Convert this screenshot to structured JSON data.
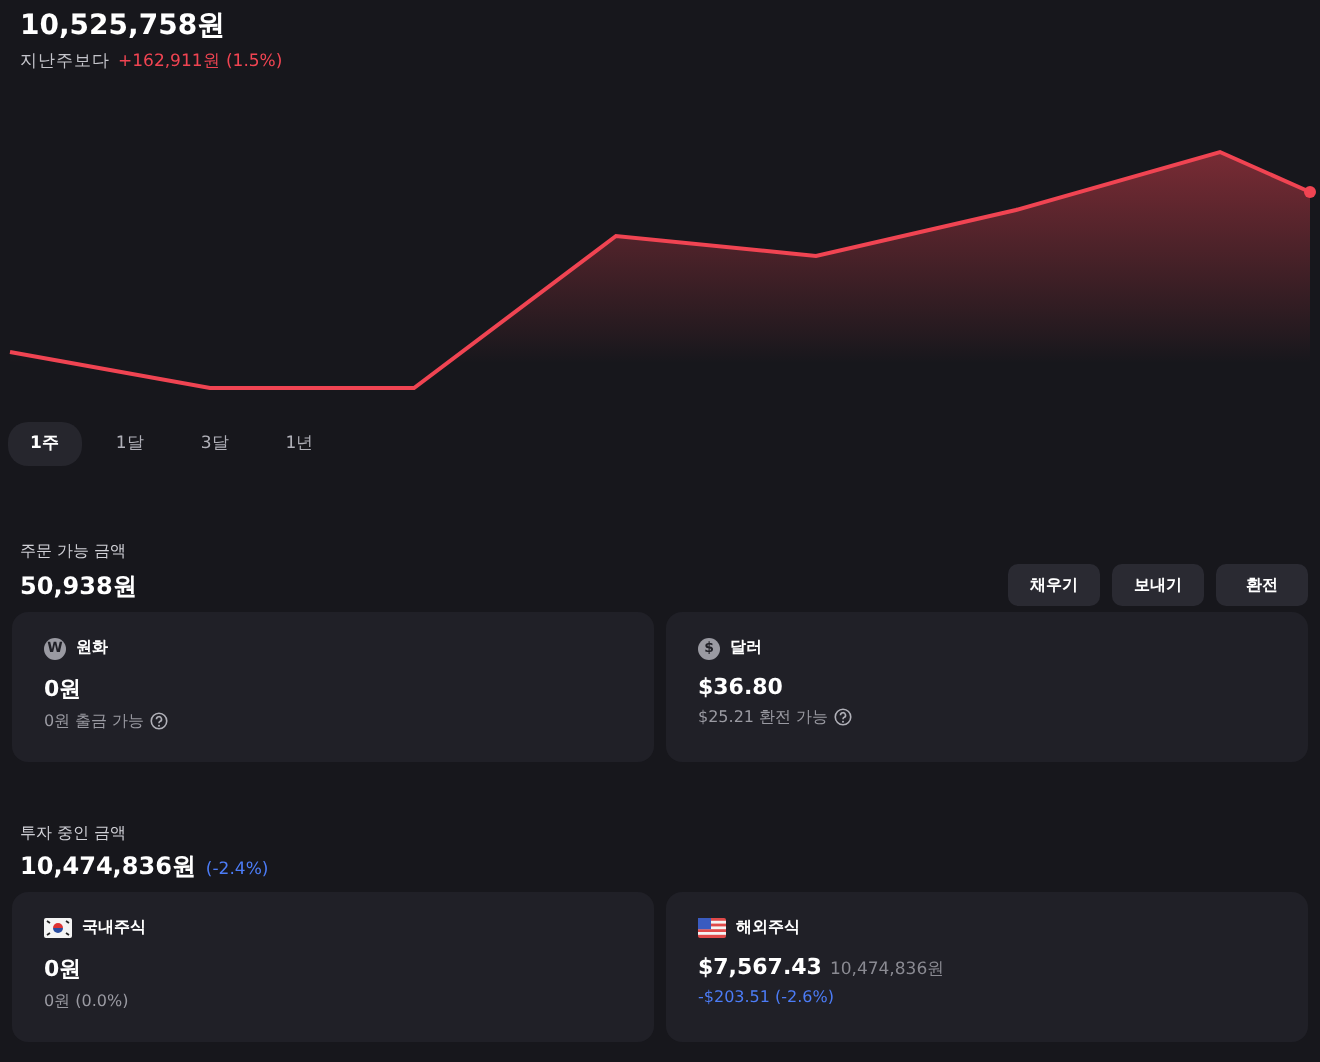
{
  "summary": {
    "total": "10,525,758원",
    "compare_label": "지난주보다",
    "change": "+162,911원 (1.5%)",
    "color": "#f04452"
  },
  "periods": [
    {
      "label": "1주",
      "selected": true
    },
    {
      "label": "1달",
      "selected": false
    },
    {
      "label": "3달",
      "selected": false
    },
    {
      "label": "1년",
      "selected": false
    }
  ],
  "orderable": {
    "label": "주문 가능 금액",
    "amount": "50,938원",
    "buttons": [
      "채우기",
      "보내기",
      "환전"
    ],
    "cards": [
      {
        "kind": "coin",
        "symbol": "W",
        "label": "원화",
        "amount": "0원",
        "detail": "0원 출금 가능",
        "help": true,
        "color": "#9a9aa2"
      },
      {
        "kind": "coin",
        "symbol": "$",
        "label": "달러",
        "amount": "$36.80",
        "detail": "$25.21 환전 가능",
        "help": true,
        "color": "#9a9aa2"
      }
    ]
  },
  "investing": {
    "label": "투자 중인 금액",
    "amount": "10,474,836원",
    "change": "(-2.4%)",
    "color": "#4c7cf6",
    "cards": [
      {
        "kind": "flag-kr",
        "label": "국내주식",
        "amount": "0원",
        "detail": "0원 (0.0%)",
        "help": false,
        "color": "#9a9aa2"
      },
      {
        "kind": "flag-us",
        "label": "해외주식",
        "amount": "$7,567.43",
        "amount_secondary": "10,474,836원",
        "detail": "-$203.51 (-2.6%)",
        "help": false,
        "color": "#4c7cf6"
      }
    ]
  }
}
